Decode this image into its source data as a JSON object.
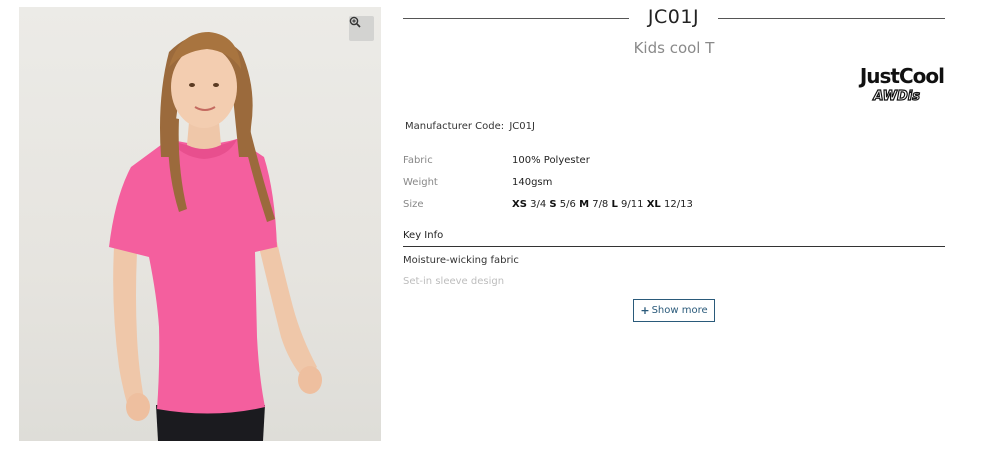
{
  "product": {
    "code": "JC01J",
    "name": "Kids cool T",
    "brand_name": "JustCool",
    "brand_sub": "AWDis",
    "manufacturer_label": "Manufacturer Code:",
    "manufacturer_code": "JC01J"
  },
  "specs": {
    "fabric_label": "Fabric",
    "fabric_value": "100% Polyester",
    "weight_label": "Weight",
    "weight_value": "140gsm",
    "size_label": "Size",
    "sizes": [
      {
        "code": "XS",
        "range": "3/4"
      },
      {
        "code": "S",
        "range": "5/6"
      },
      {
        "code": "M",
        "range": "7/8"
      },
      {
        "code": "L",
        "range": "9/11"
      },
      {
        "code": "XL",
        "range": "12/13"
      }
    ]
  },
  "key_info": {
    "title": "Key Info",
    "items": [
      "Moisture-wicking fabric",
      "Set-in sleeve design"
    ]
  },
  "actions": {
    "show_more_icon": "+",
    "show_more_label": "Show more",
    "zoom_icon": "zoom-in-icon"
  },
  "colors": {
    "tshirt": "#f45f9e",
    "accent": "#2a5a7a"
  }
}
